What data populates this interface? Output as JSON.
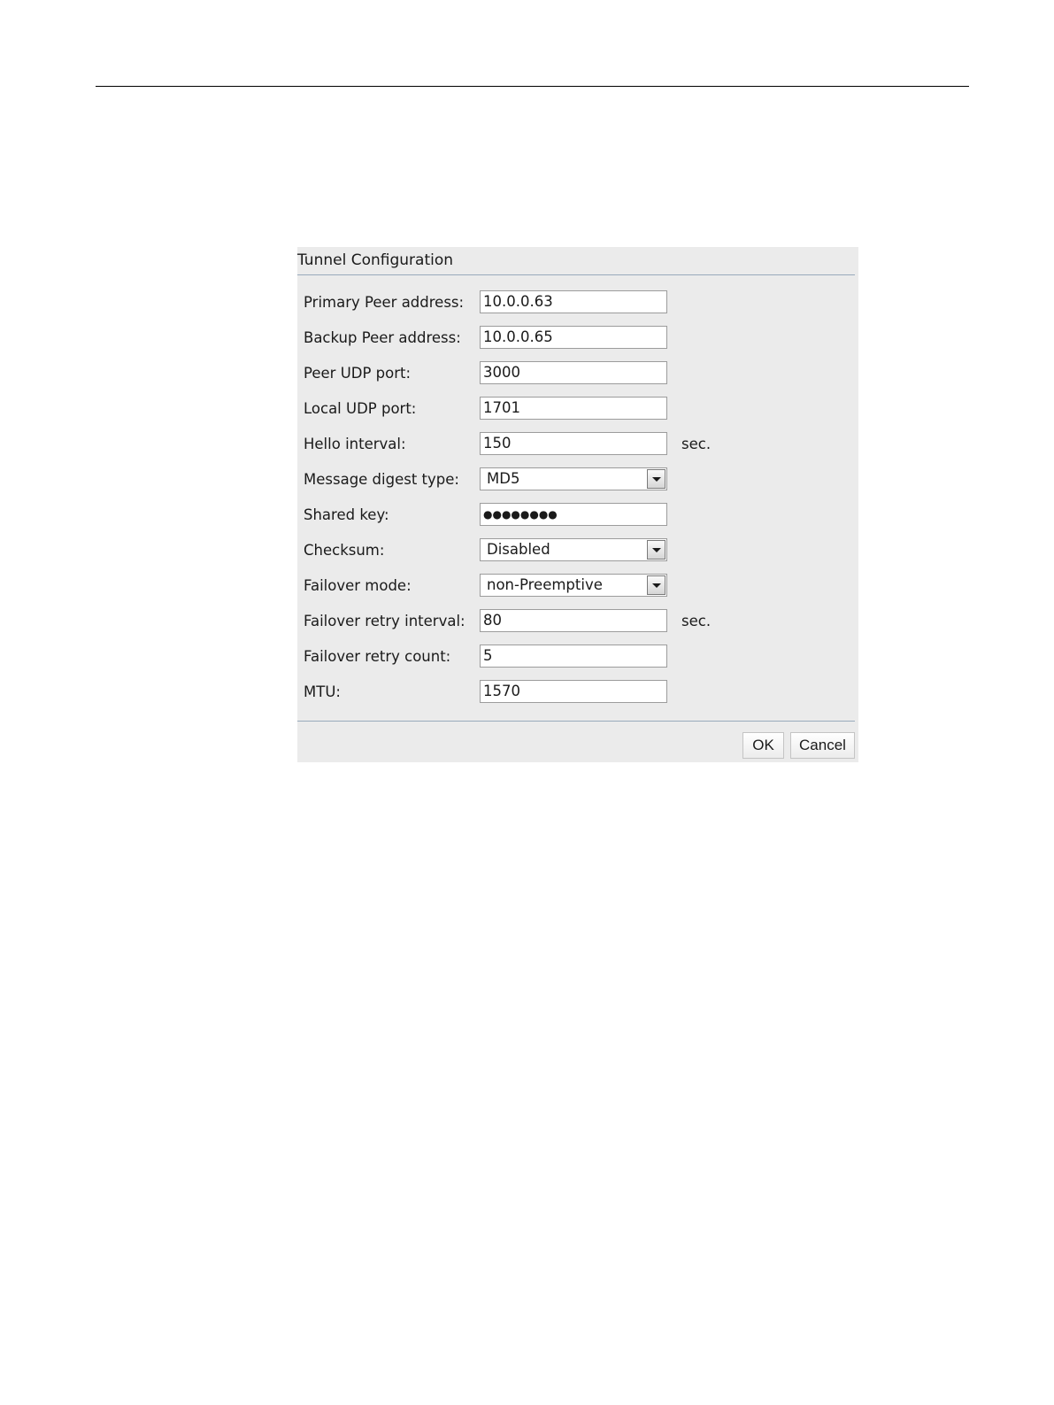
{
  "dialog": {
    "title": "Tunnel Configuration",
    "fields": {
      "primary_peer": {
        "label": "Primary Peer address:",
        "value": "10.0.0.63"
      },
      "backup_peer": {
        "label": "Backup Peer address:",
        "value": "10.0.0.65"
      },
      "peer_udp_port": {
        "label": "Peer UDP port:",
        "value": "3000"
      },
      "local_udp_port": {
        "label": "Local UDP port:",
        "value": "1701"
      },
      "hello_interval": {
        "label": "Hello interval:",
        "value": "150",
        "unit": "sec."
      },
      "message_digest_type": {
        "label": "Message digest type:",
        "value": "MD5"
      },
      "shared_key": {
        "label": "Shared key:",
        "value": "●●●●●●●●"
      },
      "checksum": {
        "label": "Checksum:",
        "value": "Disabled"
      },
      "failover_mode": {
        "label": "Failover mode:",
        "value": "non-Preemptive"
      },
      "failover_retry_interval": {
        "label": "Failover retry interval:",
        "value": "80",
        "unit": "sec."
      },
      "failover_retry_count": {
        "label": "Failover retry count:",
        "value": "5"
      },
      "mtu": {
        "label": "MTU:",
        "value": "1570"
      }
    },
    "buttons": {
      "ok": "OK",
      "cancel": "Cancel"
    }
  }
}
